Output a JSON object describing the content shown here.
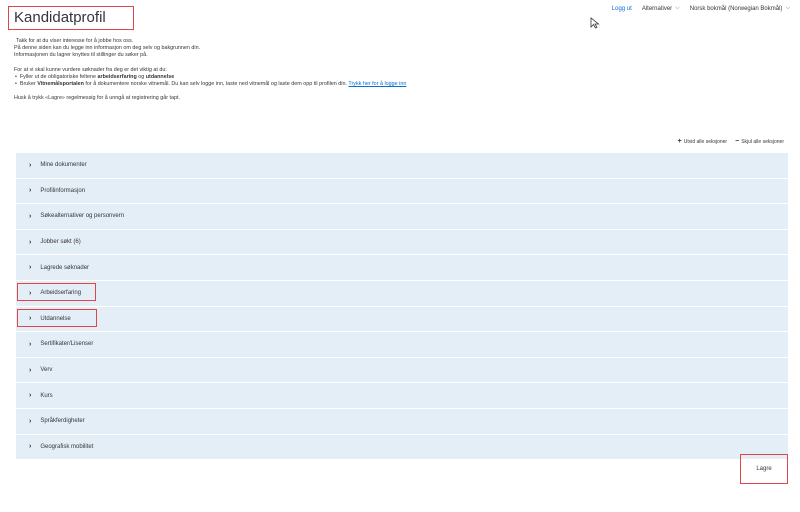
{
  "header": {
    "logout": "Logg ut",
    "alternatives": "Alternativer",
    "language": "Norsk bokmål (Norwegian Bokmål)"
  },
  "page": {
    "title": "Kandidatprofil"
  },
  "intro": {
    "line1": "Takk for at du viser interesse for å jobbe hos oss.",
    "line2": "På denne siden kan du legge inn informasjon om deg selv og bakgrunnen din.",
    "line3": "Informasjonen du lagrer knyttes til stillinger du søker på.",
    "line4": "For at vi skal kunne vurdere søknader fra deg er det viktig at du:",
    "bullet1_prefix": "Fyller ut de obligatoriske feltene ",
    "bullet1_b1": "arbeidserfaring",
    "bullet1_mid": " og ",
    "bullet1_b2": "utdannelse",
    "bullet2_prefix": "Bruker ",
    "bullet2_b": "Vitnemålsportalen",
    "bullet2_text": " for å dokumentere norske vitnemål. Du kan selv logge inn, laste ned vitnemål og laste dem opp til profilen din. ",
    "bullet2_link": "Trykk her for å logge inn",
    "line5": "Husk å trykk «Lagre» regelmessig for å unngå at registrering går tapt."
  },
  "controls": {
    "expand_all": "Utvid alle seksjoner",
    "collapse_all": "Skjul alle seksjoner"
  },
  "sections": [
    "Mine dokumenter",
    "Profilinformasjon",
    "Søkealternativer og personvern",
    "Jobber søkt (6)",
    "Lagrede søknader",
    "Arbeidserfaring",
    "Utdannelse",
    "Sertifikater/Lisenser",
    "Verv",
    "Kurs",
    "Språkferdigheter",
    "Geografisk mobilitet"
  ],
  "footer": {
    "save": "Lagre"
  },
  "colors": {
    "highlight": "#e0454c",
    "section_bg": "#e4eef7",
    "link": "#0a6ed1"
  }
}
